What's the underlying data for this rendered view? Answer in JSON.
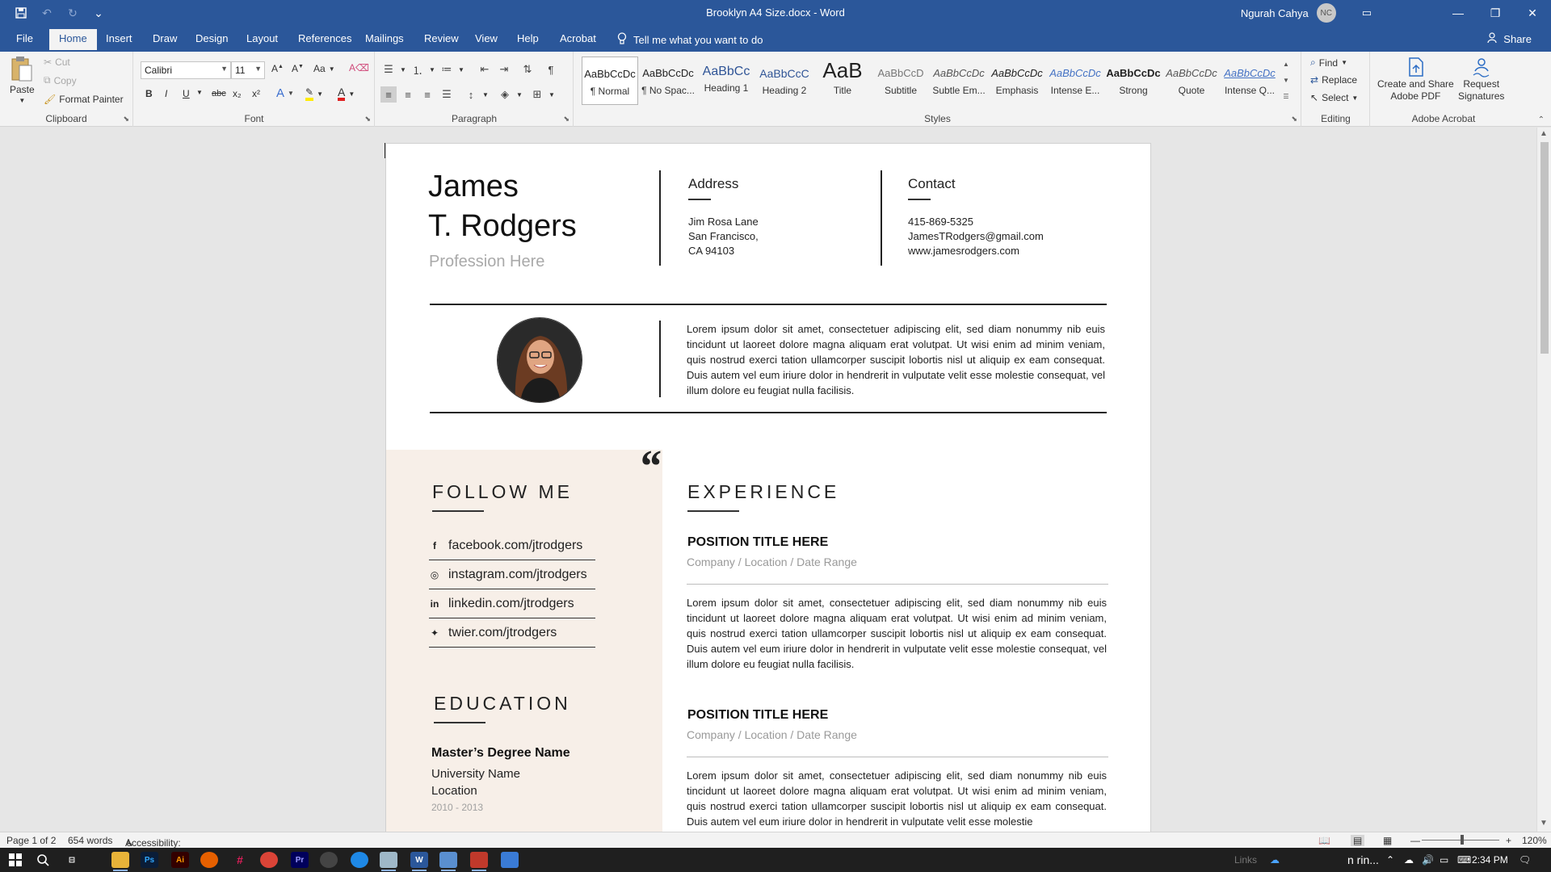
{
  "window": {
    "title": "Brooklyn A4 Size.docx  -  Word",
    "user_name": "Ngurah Cahya",
    "user_initials": "NC"
  },
  "tabs": [
    {
      "label": "File"
    },
    {
      "label": "Home"
    },
    {
      "label": "Insert"
    },
    {
      "label": "Draw"
    },
    {
      "label": "Design"
    },
    {
      "label": "Layout"
    },
    {
      "label": "References"
    },
    {
      "label": "Mailings"
    },
    {
      "label": "Review"
    },
    {
      "label": "View"
    },
    {
      "label": "Help"
    },
    {
      "label": "Acrobat"
    }
  ],
  "tell_me": "Tell me what you want to do",
  "share": "Share",
  "clipboard": {
    "label": "Clipboard",
    "paste": "Paste",
    "cut": "Cut",
    "copy": "Copy",
    "format_painter": "Format Painter"
  },
  "font": {
    "label": "Font",
    "name": "Calibri",
    "size": "11",
    "change_case": "Aa",
    "bold": "B",
    "italic": "I",
    "underline": "U",
    "strike": "abc",
    "subscript": "x₂",
    "superscript": "x²"
  },
  "paragraph": {
    "label": "Paragraph"
  },
  "styles": {
    "label": "Styles",
    "items": [
      {
        "sample": "AaBbCcDc",
        "name": "¶ Normal"
      },
      {
        "sample": "AaBbCcDc",
        "name": "¶ No Spac..."
      },
      {
        "sample": "AaBbCc",
        "name": "Heading 1"
      },
      {
        "sample": "AaBbCcC",
        "name": "Heading 2"
      },
      {
        "sample": "AaB",
        "name": "Title"
      },
      {
        "sample": "AaBbCcD",
        "name": "Subtitle"
      },
      {
        "sample": "AaBbCcDc",
        "name": "Subtle Em..."
      },
      {
        "sample": "AaBbCcDc",
        "name": "Emphasis"
      },
      {
        "sample": "AaBbCcDc",
        "name": "Intense E..."
      },
      {
        "sample": "AaBbCcDc",
        "name": "Strong"
      },
      {
        "sample": "AaBbCcDc",
        "name": "Quote"
      },
      {
        "sample": "AaBbCcDc",
        "name": "Intense Q..."
      }
    ]
  },
  "editing": {
    "label": "Editing",
    "find": "Find",
    "replace": "Replace",
    "select": "Select"
  },
  "acrobat": {
    "label": "Adobe Acrobat",
    "create_line1": "Create and Share",
    "create_line2": "Adobe PDF",
    "request_line1": "Request",
    "request_line2": "Signatures"
  },
  "resume": {
    "first_name": "James",
    "last_name": "T. Rodgers",
    "profession": "Profession Here",
    "address_heading": "Address",
    "address_lines": [
      "Jim Rosa Lane",
      "San Francisco,",
      "CA 94103"
    ],
    "contact_heading": "Contact",
    "contact_lines": [
      "415-869-5325",
      "JamesTRodgers@gmail.com",
      "www.jamesrodgers.com"
    ],
    "summary": "Lorem ipsum dolor sit amet, consectetuer adipiscing elit, sed diam nonummy nib euis tincidunt ut laoreet dolore magna aliquam erat volutpat. Ut wisi enim ad minim veniam, quis nostrud exerci tation ullamcorper suscipit lobortis nisl ut aliquip ex eam consequat. Duis autem vel eum iriure dolor in hendrerit in vulputate velit esse molestie consequat, vel illum dolore eu feugiat nulla facilisis.",
    "quote_mark": "“",
    "follow_heading": "FOLLOW ME",
    "social": [
      {
        "icon": "f",
        "text": "facebook.com/jtrodgers"
      },
      {
        "icon": "◎",
        "text": "instagram.com/jtrodgers"
      },
      {
        "icon": "in",
        "text": "linkedin.com/jtrodgers"
      },
      {
        "icon": "✦",
        "text": "twier.com/jtrodgers"
      }
    ],
    "education_heading": "EDUCATION",
    "education": {
      "degree": "Master’s Degree Name",
      "university": "University Name",
      "location": "Location",
      "years": "2010 - 2013"
    },
    "experience_heading": "EXPERIENCE",
    "jobs": [
      {
        "title": "POSITION TITLE HERE",
        "sub": "Company / Location / Date Range",
        "desc": "Lorem ipsum dolor sit amet, consectetuer adipiscing elit, sed diam nonummy nib euis tincidunt ut laoreet dolore magna aliquam erat volutpat. Ut wisi enim ad minim veniam, quis nostrud exerci tation ullamcorper suscipit lobortis nisl ut aliquip ex eam consequat. Duis autem vel eum iriure dolor in hendrerit in vulputate velit esse molestie consequat, vel illum dolore eu feugiat nulla facilisis."
      },
      {
        "title": "POSITION TITLE HERE",
        "sub": "Company / Location / Date Range",
        "desc": "Lorem ipsum dolor sit amet, consectetuer adipiscing elit, sed diam nonummy nib euis tincidunt ut laoreet dolore magna aliquam erat volutpat. Ut wisi enim ad minim veniam, quis nostrud exerci tation ullamcorper suscipit lobortis nisl ut aliquip ex eam consequat. Duis autem vel eum iriure dolor in hendrerit in vulputate velit esse molestie"
      }
    ]
  },
  "status": {
    "page": "Page 1 of 2",
    "words": "654 words",
    "accessibility": "Accessibility: Good to go",
    "zoom": "120%"
  },
  "taskbar": {
    "time": "2:34 PM",
    "links": "Links",
    "ticker": "n rin..."
  }
}
